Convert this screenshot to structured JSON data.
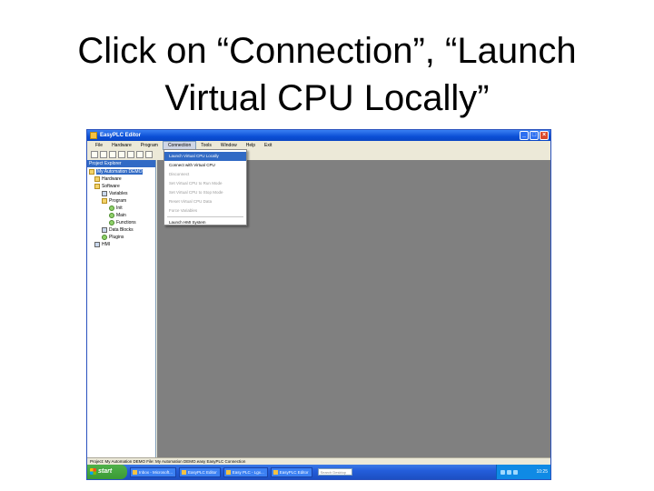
{
  "slide": {
    "title": "Click on “Connection”, “Launch Virtual CPU Locally”"
  },
  "window": {
    "title": "EasyPLC Editor",
    "minimize_glyph": "_",
    "maximize_glyph": "□",
    "close_glyph": "×"
  },
  "menubar": {
    "items": [
      "File",
      "Hardware",
      "Program",
      "Connection",
      "Tools",
      "Window",
      "Help",
      "Exit"
    ],
    "active": "Connection"
  },
  "toolbar": {
    "icons": [
      "new-icon",
      "open-icon",
      "save-icon",
      "cut-icon",
      "copy-icon",
      "paste-icon",
      "settings-icon"
    ]
  },
  "explorer": {
    "title": "Project Explorer",
    "items": [
      {
        "label": "My Automation DEMO",
        "icon": "folder-icon"
      },
      {
        "label": "Hardware",
        "icon": "folder-icon"
      },
      {
        "label": "Software",
        "icon": "folder-icon"
      },
      {
        "label": "Variables",
        "icon": "document-icon"
      },
      {
        "label": "Program",
        "icon": "folder-icon"
      },
      {
        "label": "Init",
        "icon": "gear-icon"
      },
      {
        "label": "Main",
        "icon": "gear-icon"
      },
      {
        "label": "Functions",
        "icon": "gear-icon"
      },
      {
        "label": "Data Blocks",
        "icon": "document-icon"
      },
      {
        "label": "Plugins",
        "icon": "gear-icon"
      },
      {
        "label": "HMI",
        "icon": "monitor-icon"
      }
    ]
  },
  "connection_menu": {
    "items": [
      {
        "label": "Launch Virtual CPU Locally",
        "state": "highlighted"
      },
      {
        "label": "Connect with Virtual CPU",
        "state": "enabled"
      },
      {
        "label": "Disconnect",
        "state": "disabled"
      },
      {
        "label": "Set Virtual CPU to Run Mode",
        "state": "disabled"
      },
      {
        "label": "Set Virtual CPU to Stop Mode",
        "state": "disabled"
      },
      {
        "label": "Reset Virtual CPU Data",
        "state": "disabled"
      },
      {
        "label": "Force Variables",
        "state": "disabled"
      },
      {
        "label": "Launch HMI System",
        "state": "enabled"
      }
    ]
  },
  "statusbar": {
    "text": "Project: My Automation DEMO   File: My Automation DEMO.easy   EasyPLC Connection"
  },
  "taskbar": {
    "start_label": "start",
    "items": [
      "Inbox - Microsoft...",
      "EasyPLC Editor",
      "Easy PLC - Lgx...",
      "EasyPLC Editor"
    ],
    "search_placeholder": "Search Desktop",
    "clock": "10:25"
  },
  "colors": {
    "titlebar": "#0b4fd6",
    "menu_highlight": "#316ac5",
    "workspace": "#808080",
    "taskbar": "#245edb",
    "start_button": "#3a9a35"
  }
}
